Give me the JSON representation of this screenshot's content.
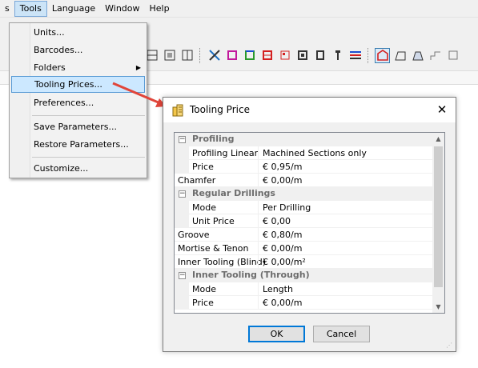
{
  "menubar": {
    "items": [
      {
        "label": "s"
      },
      {
        "label": "Tools"
      },
      {
        "label": "Language"
      },
      {
        "label": "Window"
      },
      {
        "label": "Help"
      }
    ]
  },
  "menu": {
    "items": [
      {
        "label": "Units..."
      },
      {
        "label": "Barcodes..."
      },
      {
        "label": "Folders"
      },
      {
        "label": "Tooling Prices..."
      },
      {
        "label": "Preferences..."
      },
      {
        "label": "Save Parameters..."
      },
      {
        "label": "Restore Parameters..."
      },
      {
        "label": "Customize..."
      }
    ],
    "submenu_arrow": "▶"
  },
  "dialog": {
    "title": "Tooling Price",
    "close_glyph": "✕",
    "rows": [
      {
        "type": "group",
        "toggle": "−",
        "label": "Profiling"
      },
      {
        "type": "child",
        "label": "Profiling Linear",
        "value": "Machined Sections only"
      },
      {
        "type": "child",
        "label": "Price",
        "value": "€ 0,95/m"
      },
      {
        "type": "item",
        "label": "Chamfer",
        "value": "€ 0,00/m"
      },
      {
        "type": "group",
        "toggle": "−",
        "label": "Regular Drillings"
      },
      {
        "type": "child",
        "label": "Mode",
        "value": "Per Drilling"
      },
      {
        "type": "child",
        "label": "Unit Price",
        "value": "€ 0,00"
      },
      {
        "type": "item",
        "label": "Groove",
        "value": "€ 0,80/m"
      },
      {
        "type": "item",
        "label": "Mortise & Tenon",
        "value": "€ 0,00/m"
      },
      {
        "type": "item",
        "label": "Inner Tooling (Blind)",
        "value": "€ 0,00/m²"
      },
      {
        "type": "group",
        "toggle": "−",
        "label": "Inner Tooling (Through)"
      },
      {
        "type": "child",
        "label": "Mode",
        "value": "Length"
      },
      {
        "type": "child",
        "label": "Price",
        "value": "€ 0,00/m"
      }
    ],
    "scroll_up": "▲",
    "scroll_down": "▼",
    "ok_label": "OK",
    "cancel_label": "Cancel"
  },
  "colors": {
    "menu_highlight": "#cce8ff",
    "arrow": "#e0453a",
    "group_text": "#6d6d6d"
  }
}
